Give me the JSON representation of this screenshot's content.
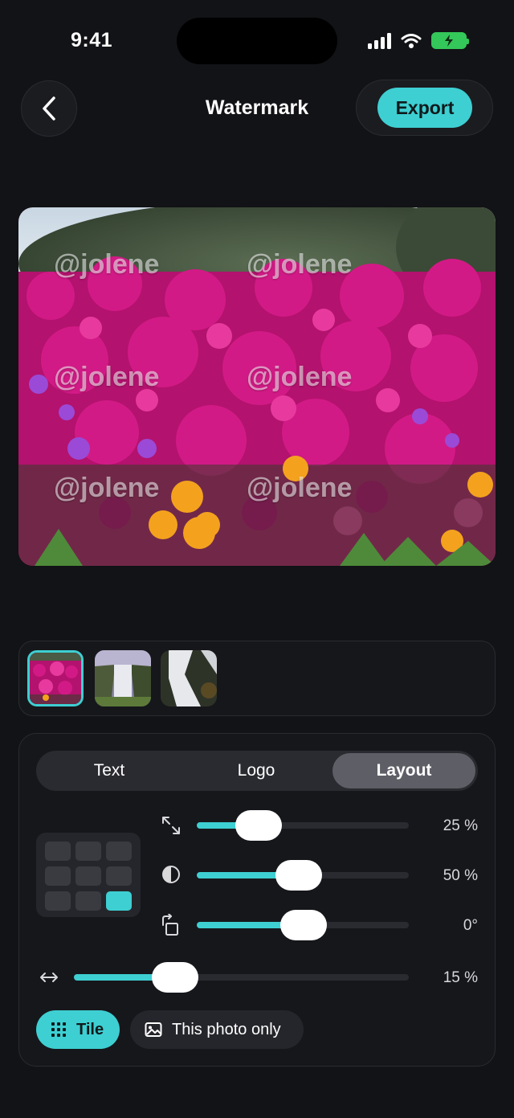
{
  "status_bar": {
    "time": "9:41"
  },
  "header": {
    "title": "Watermark",
    "export_label": "Export"
  },
  "icons": {
    "back": "chevron-left-icon",
    "resize": "resize-diagonal-icon",
    "opacity": "half-circle-icon",
    "rotate": "rotate-icon",
    "spacing": "horizontal-arrows-icon",
    "tile": "grid-dots-icon",
    "photo": "image-icon"
  },
  "preview": {
    "watermark_text": "@jolene"
  },
  "thumbnails": {
    "selected_index": 0,
    "count": 3
  },
  "tabs": [
    {
      "label": "Text",
      "active": false
    },
    {
      "label": "Logo",
      "active": false
    },
    {
      "label": "Layout",
      "active": true
    }
  ],
  "position_grid": {
    "selected_cell": 8
  },
  "sliders": {
    "size": {
      "display": "25 %",
      "fraction": 0.25
    },
    "opacity": {
      "display": "50 %",
      "fraction": 0.5
    },
    "rotation": {
      "display": "0°",
      "fraction": 0.5
    },
    "spacing": {
      "display": "15 %",
      "fraction": 0.3
    }
  },
  "apply_options": {
    "tile_label": "Tile",
    "photo_only_label": "This photo only",
    "selected": "tile"
  },
  "colors": {
    "accent": "#3ecfd2",
    "background": "#121316",
    "battery": "#34c759"
  }
}
